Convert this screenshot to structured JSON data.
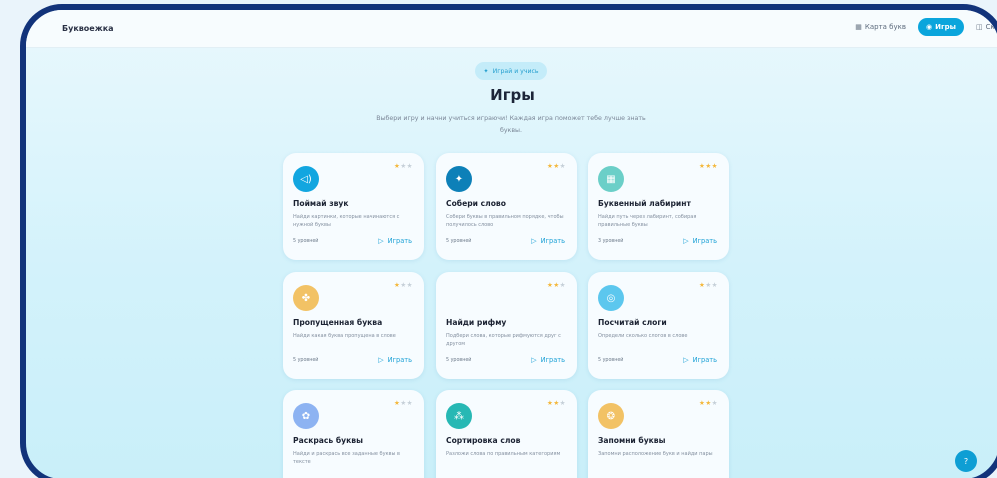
{
  "nav": {
    "brand": "Буквоежка",
    "items": [
      {
        "label": "Карта букв",
        "icon": "map-icon",
        "glyph": "▦"
      },
      {
        "label": "Игры",
        "icon": "gamepad-icon",
        "glyph": "◉"
      },
      {
        "label": "Ска",
        "icon": "book-icon",
        "glyph": "◫"
      }
    ]
  },
  "hero": {
    "pill_label": "Играй и учись",
    "title": "Игры",
    "subtitle": "Выбери игру и начни учиться играючи! Каждая игра поможет тебе лучше знать буквы."
  },
  "cards": [
    {
      "title": "Поймай звук",
      "description": "Найди картинки, которые начинаются с нужной буквы",
      "levels": "5 уровней",
      "play": "Играть",
      "stars": 1,
      "icon": "speaker-icon",
      "glyph": "◁)",
      "color": "#12a6e0"
    },
    {
      "title": "Собери слово",
      "description": "Собери буквы в правильном порядке, чтобы получилось слово",
      "levels": "5 уровней",
      "play": "Играть",
      "stars": 2,
      "icon": "sparkle-icon",
      "glyph": "✦",
      "color": "#0d80b8"
    },
    {
      "title": "Буквенный лабиринт",
      "description": "Найди путь через лабиринт, собирая правильные буквы",
      "levels": "3 уровней",
      "play": "Играть",
      "stars": 3,
      "icon": "grid-icon",
      "glyph": "▦",
      "color": "#6bcfc8"
    },
    {
      "title": "Пропущенная буква",
      "description": "Найди какая буква пропущена в слове",
      "levels": "5 уровней",
      "play": "Играть",
      "stars": 1,
      "icon": "puzzle-icon",
      "glyph": "✤",
      "color": "#f2c265"
    },
    {
      "title": "Найди рифму",
      "description": "Подбери слова, которые рифмуются друг с другом",
      "levels": "5 уровней",
      "play": "Играть",
      "stars": 2,
      "icon": "",
      "glyph": "",
      "color": ""
    },
    {
      "title": "Посчитай слоги",
      "description": "Определи сколько слогов в слове",
      "levels": "5 уровней",
      "play": "Играть",
      "stars": 1,
      "icon": "target-icon",
      "glyph": "◎",
      "color": "#5cc7ee"
    },
    {
      "title": "Раскрась буквы",
      "description": "Найди и раскрась все заданные буквы в тексте",
      "levels": "",
      "play": "",
      "stars": 1,
      "icon": "palette-icon",
      "glyph": "✿",
      "color": "#8db3f2"
    },
    {
      "title": "Сортировка слов",
      "description": "Разложи слова по правильным категориям",
      "levels": "",
      "play": "",
      "stars": 2,
      "icon": "shapes-icon",
      "glyph": "⁂",
      "color": "#27b8b4"
    },
    {
      "title": "Запомни буквы",
      "description": "Запомни расположение букв и найди пары",
      "levels": "",
      "play": "",
      "stars": 2,
      "icon": "brain-icon",
      "glyph": "❂",
      "color": "#f2c265"
    }
  ],
  "help": {
    "icon": "help-icon",
    "glyph": "?"
  }
}
